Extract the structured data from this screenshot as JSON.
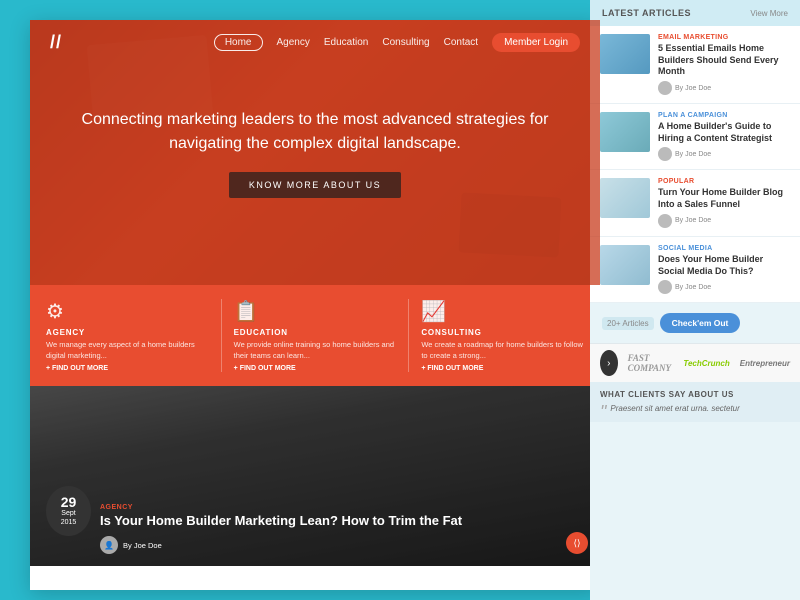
{
  "site": {
    "logo": "//",
    "nav": {
      "links": [
        "Home",
        "Agency",
        "Education",
        "Consulting",
        "Contact"
      ],
      "active": "Home",
      "member_btn": "Member Login"
    },
    "hero": {
      "title": "Connecting marketing leaders to the most advanced strategies for navigating the complex digital landscape.",
      "cta_btn": "KNOW MORE ABOUT US"
    },
    "services": [
      {
        "icon": "⚙",
        "title": "AGENCY",
        "desc": "We manage every aspect of a home builders digital marketing...",
        "link": "+ FIND OUT MORE"
      },
      {
        "icon": "📋",
        "title": "EDUCATION",
        "desc": "We provide online training so home builders and their teams can learn...",
        "link": "+ FIND OUT MORE"
      },
      {
        "icon": "📈",
        "title": "CONSULTING",
        "desc": "We create a roadmap for home builders to follow to create a strong...",
        "link": "+ FIND OUT MORE"
      }
    ],
    "blog_post": {
      "date_day": "29",
      "date_month": "Sept",
      "date_year": "2015",
      "category": "AGENCY",
      "title": "Is Your Home Builder Marketing Lean? How to Trim the Fat",
      "author": "By Joe Doe"
    }
  },
  "right_panel": {
    "header": {
      "label": "LATEST ARTICLES",
      "view_more": "View More"
    },
    "articles": [
      {
        "category": "EMAIL MARKETING",
        "category_class": "tag-email",
        "title": "5 Essential Emails Home Builders Should Send Every Month",
        "author": "By Joe Doe"
      },
      {
        "category": "PLAN A CAMPAIGN",
        "category_class": "tag-plan",
        "title": "A Home Builder's Guide to Hiring a Content Strategist",
        "author": "By Joe Doe"
      },
      {
        "category": "POPULAR",
        "category_class": "tag-popular",
        "title": "Turn Your Home Builder Blog Into a Sales Funnel",
        "author": "By Joe Doe"
      },
      {
        "category": "SOCIAL MEDIA",
        "category_class": "tag-social",
        "title": "Does Your Home Builder Social Media Do This?",
        "author": "By Joe Doe"
      }
    ],
    "cta": {
      "count": "20+ Articles",
      "btn": "Check'em Out"
    },
    "brands": [
      "FAST COMPANY",
      "TechCrunch",
      "Entrepreneur"
    ],
    "testimonial": {
      "section_title": "WHAT CLIENTS SAY ABOUT US",
      "text": "Praesent sit amet erat urna. sectetur"
    }
  }
}
